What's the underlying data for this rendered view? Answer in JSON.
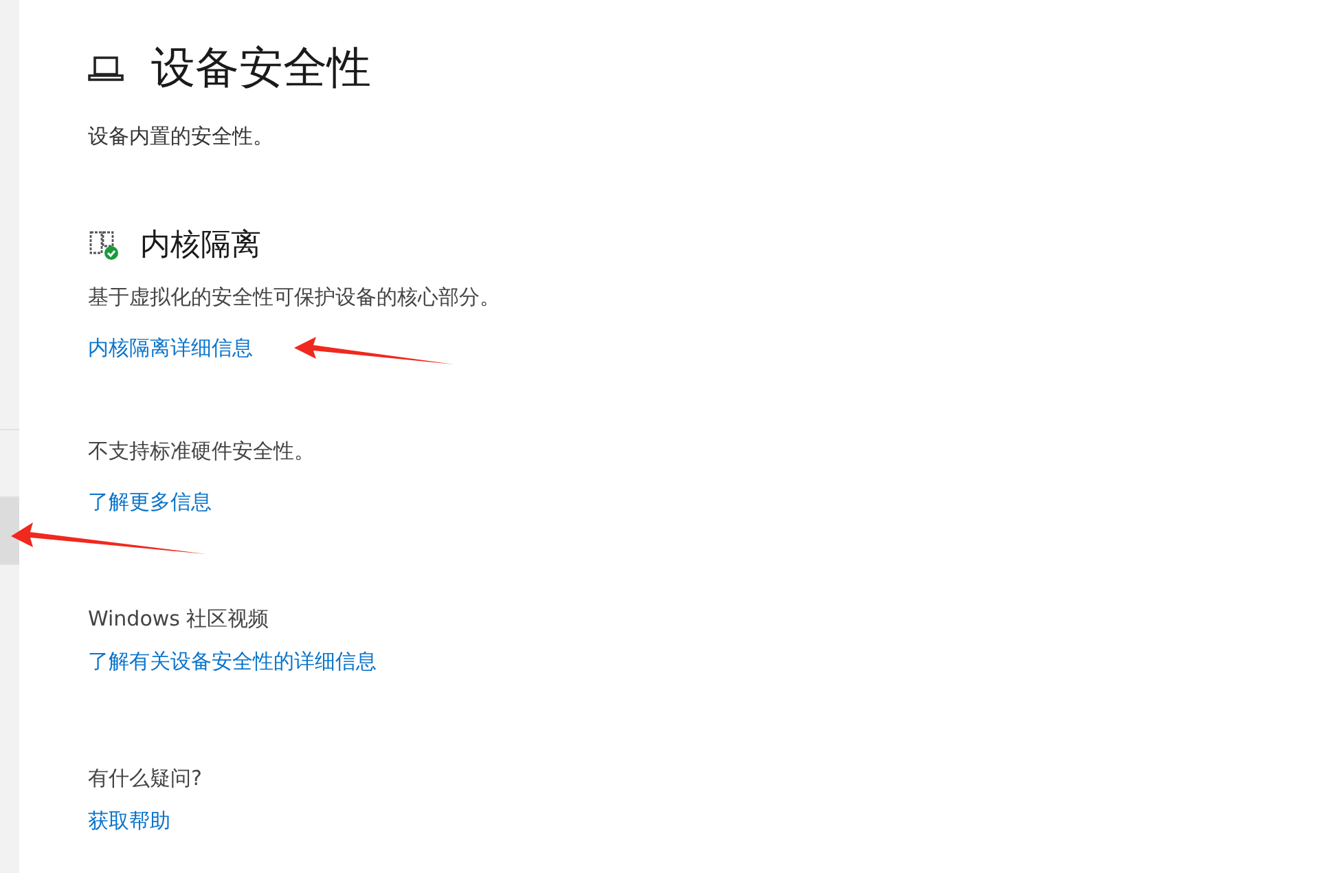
{
  "sidebar": {
    "items": [
      {
        "selected": false
      },
      {
        "selected": true
      },
      {
        "selected": false
      }
    ]
  },
  "page": {
    "title": "设备安全性",
    "subtitle": "设备内置的安全性。"
  },
  "sections": [
    {
      "kind": "feature",
      "heading": "内核隔离",
      "description": "基于虚拟化的安全性可保护设备的核心部分。",
      "link": "内核隔离详细信息"
    },
    {
      "kind": "plain",
      "description": "不支持标准硬件安全性。",
      "link": "了解更多信息"
    },
    {
      "kind": "plain",
      "description": "Windows 社区视频",
      "link": "了解有关设备安全性的详细信息"
    },
    {
      "kind": "plain",
      "description": "有什么疑问?",
      "link": "获取帮助"
    }
  ]
}
